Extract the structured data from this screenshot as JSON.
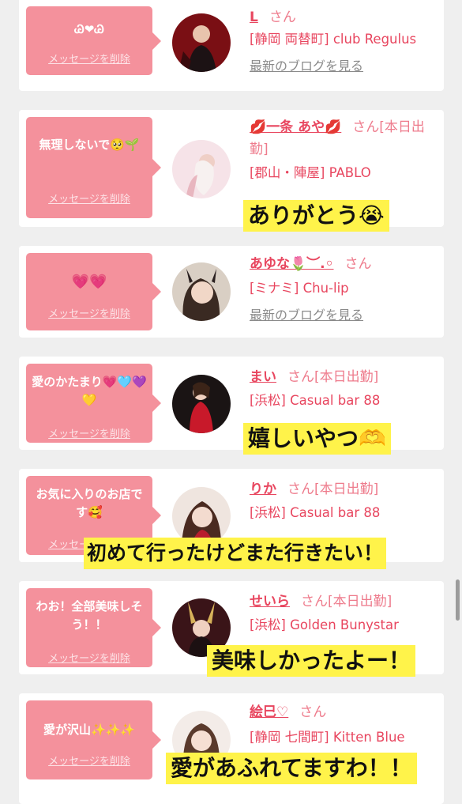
{
  "delete_label": "メッセージを削除",
  "blog_label": "最新のブログを見る",
  "san": "さん",
  "cards": [
    {
      "message": "Ꮚ❤︎Ꮚ",
      "name": "L",
      "status": "",
      "shop": "[静岡 両替町] club Regulus",
      "blog": true,
      "overlay": ""
    },
    {
      "message": "無理しないで🥺🌱",
      "name": "💋一条 あや💋",
      "status": "[本日出勤]",
      "shop": "[郡山・陣屋] PABLO",
      "blog": false,
      "overlay": "ありがとう😭"
    },
    {
      "message": "💗💗",
      "name": "あゆな🌷︶.◦",
      "status": "",
      "shop": "[ミナミ] Chu-lip",
      "blog": true,
      "overlay": ""
    },
    {
      "message": "愛のかたまり💗🩵💜💛",
      "name": "まい",
      "status": "[本日出勤]",
      "shop": "[浜松] Casual bar 88",
      "blog": false,
      "overlay": "嬉しいやつ🫶"
    },
    {
      "message": "お気に入りのお店です🥰",
      "name": "りか",
      "status": "[本日出勤]",
      "shop": "[浜松] Casual bar 88",
      "blog": false,
      "overlay": "初めて行ったけどまた行きたい！"
    },
    {
      "message": "わお！全部美味しそう！！",
      "name": "せいら",
      "status": "[本日出勤]",
      "shop": "[浜松] Golden Bunystar",
      "blog": false,
      "overlay": "美味しかったよー！"
    },
    {
      "message": "愛が沢山✨✨✨",
      "name": "絵巳♡",
      "status": "",
      "shop": "[静岡 七間町] Kitten Blue",
      "blog": false,
      "overlay": "愛があふれてますわ！！"
    }
  ],
  "colors": {
    "bubble": "#f4919c",
    "name": "#e8465f",
    "overlay": "#fff34a"
  }
}
